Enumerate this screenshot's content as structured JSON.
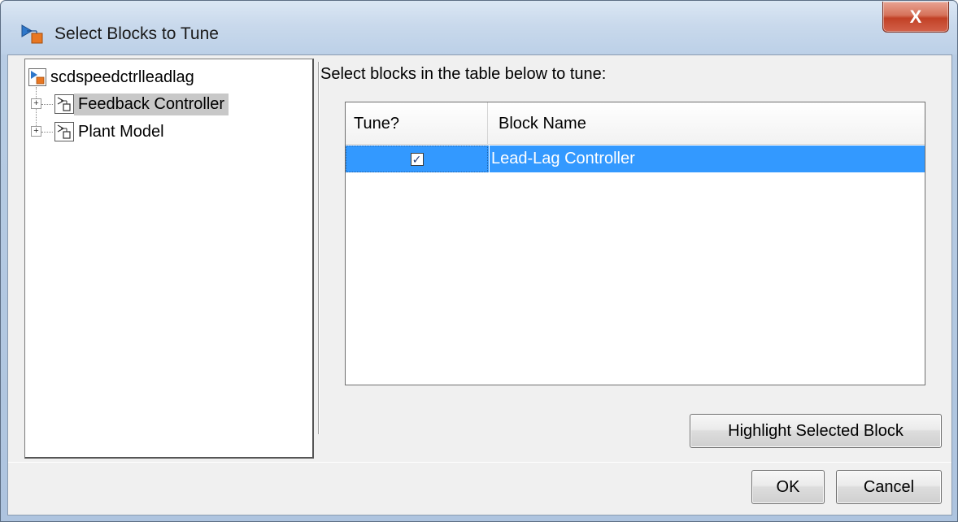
{
  "window": {
    "title": "Select Blocks to Tune",
    "close_label": "X"
  },
  "tree": {
    "root": "scdspeedctrlleadlag",
    "children": [
      {
        "label": "Feedback Controller",
        "expander": "+",
        "selected": true
      },
      {
        "label": "Plant Model",
        "expander": "+",
        "selected": false
      }
    ]
  },
  "main": {
    "instruction": "Select blocks in the table below to tune:",
    "table": {
      "headers": [
        "Tune?",
        "Block Name"
      ],
      "rows": [
        {
          "tune": true,
          "check_glyph": "✓",
          "block_name": "Lead-Lag Controller",
          "selected": true
        }
      ]
    }
  },
  "buttons": {
    "highlight": "Highlight Selected Block",
    "ok": "OK",
    "cancel": "Cancel"
  },
  "colors": {
    "selection_blue": "#3399ff",
    "tree_selection_gray": "#c8c8c8",
    "close_red": "#c24126"
  },
  "icons": {
    "window": "simulink-model-icon",
    "subsystem": "subsystem-block-icon",
    "close": "close-icon"
  }
}
